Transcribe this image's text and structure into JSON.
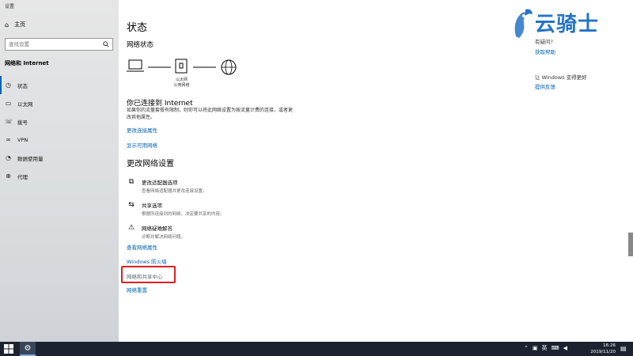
{
  "window": {
    "title": "设置"
  },
  "sidebar": {
    "home_label": "主页",
    "search_placeholder": "查找设置",
    "section_title": "网络和 Internet",
    "items": [
      {
        "label": "状态",
        "icon": "status-icon"
      },
      {
        "label": "以太网",
        "icon": "ethernet-icon"
      },
      {
        "label": "拨号",
        "icon": "dialup-icon"
      },
      {
        "label": "VPN",
        "icon": "vpn-icon"
      },
      {
        "label": "数据使用量",
        "icon": "data-usage-icon"
      },
      {
        "label": "代理",
        "icon": "proxy-icon"
      }
    ]
  },
  "main": {
    "title": "状态",
    "network_status": "网络状态",
    "diagram": {
      "adapter_label": "以太网",
      "network_label": "公用网络"
    },
    "connected_title": "你已连接到 Internet",
    "connected_desc": "如果你的流量套餐有限制，则你可以将此网络设置为按流量计费的连接，或者更改其他属性。",
    "link_change_props": "更改连接属性",
    "link_show_networks": "显示可用网络",
    "change_settings_title": "更改网络设置",
    "options": [
      {
        "title": "更改适配器选项",
        "desc": "查看网络适配器并更改连接设置。",
        "icon": "adapter-icon"
      },
      {
        "title": "共享选项",
        "desc": "根据所连接到的网络，决定要共享的内容。",
        "icon": "sharing-icon"
      },
      {
        "title": "网络疑难解答",
        "desc": "诊断并解决网络问题。",
        "icon": "warning-icon"
      }
    ],
    "link_view_props": "查看网络属性",
    "link_firewall": "Windows 防火墙",
    "link_sharing_center": "网络和共享中心",
    "link_reset": "网络重置"
  },
  "right_panel": {
    "logo_text": "云骑士",
    "help_question": "有疑问?",
    "help_link": "获取帮助",
    "improve_text": "让 Windows 变得更好",
    "feedback_link": "提供反馈"
  },
  "taskbar": {
    "time": "16:26",
    "date": "2019/11/20",
    "ime": "英"
  },
  "colors": {
    "accent": "#0063b1",
    "highlight": "#e02020",
    "taskbar": "#1c2230"
  }
}
